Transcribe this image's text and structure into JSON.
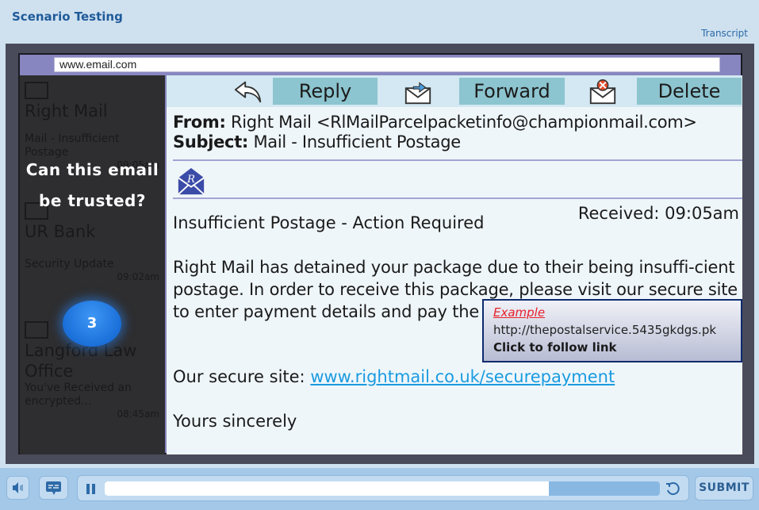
{
  "app": {
    "title": "Scenario Testing",
    "transcript_label": "Transcript"
  },
  "browser": {
    "address": "www.email.com"
  },
  "sidebar": {
    "items": [
      {
        "name": "Right Mail",
        "preview": "Mail - Insufficient Postage",
        "time": "09:05am"
      },
      {
        "name": "UR Bank",
        "preview": "Security Update",
        "time": "09:02am"
      },
      {
        "name": "Langford Law Office",
        "preview": "You've Received an encrypted...",
        "time": "08:45am"
      }
    ],
    "overlay_question": "Can this email be trusted?",
    "question_number": "3"
  },
  "toolbar": {
    "reply_label": "Reply",
    "forward_label": "Forward",
    "delete_label": "Delete"
  },
  "email": {
    "from_label": "From:",
    "from_value": "Right Mail <RlMailParcelpacketinfo@championmail.com>",
    "subject_label": "Subject:",
    "subject_value": "Mail - Insufficient Postage",
    "received": "Received: 09:05am",
    "heading": "Insufficient Postage - Action Required",
    "body": "Right Mail has detained your package due to their being insuffi-cient postage. In order to receive this package, please visit our secure site to enter payment details and pay the extra postage costs.",
    "secure_prefix": "Our secure site:",
    "secure_link": "www.rightmail.co.uk/securepayment",
    "signoff": "Yours sincerely"
  },
  "tooltip": {
    "label": "Example",
    "url": "http://thepostalservice.5435gkdgs.pk",
    "cta": "Click to follow link"
  },
  "player": {
    "progress_fraction": 0.8,
    "submit_label": "SUBMIT",
    "colors": {
      "accent": "#1f5a9a",
      "badge": "#1b6fd9",
      "link": "#1a9be0"
    }
  }
}
